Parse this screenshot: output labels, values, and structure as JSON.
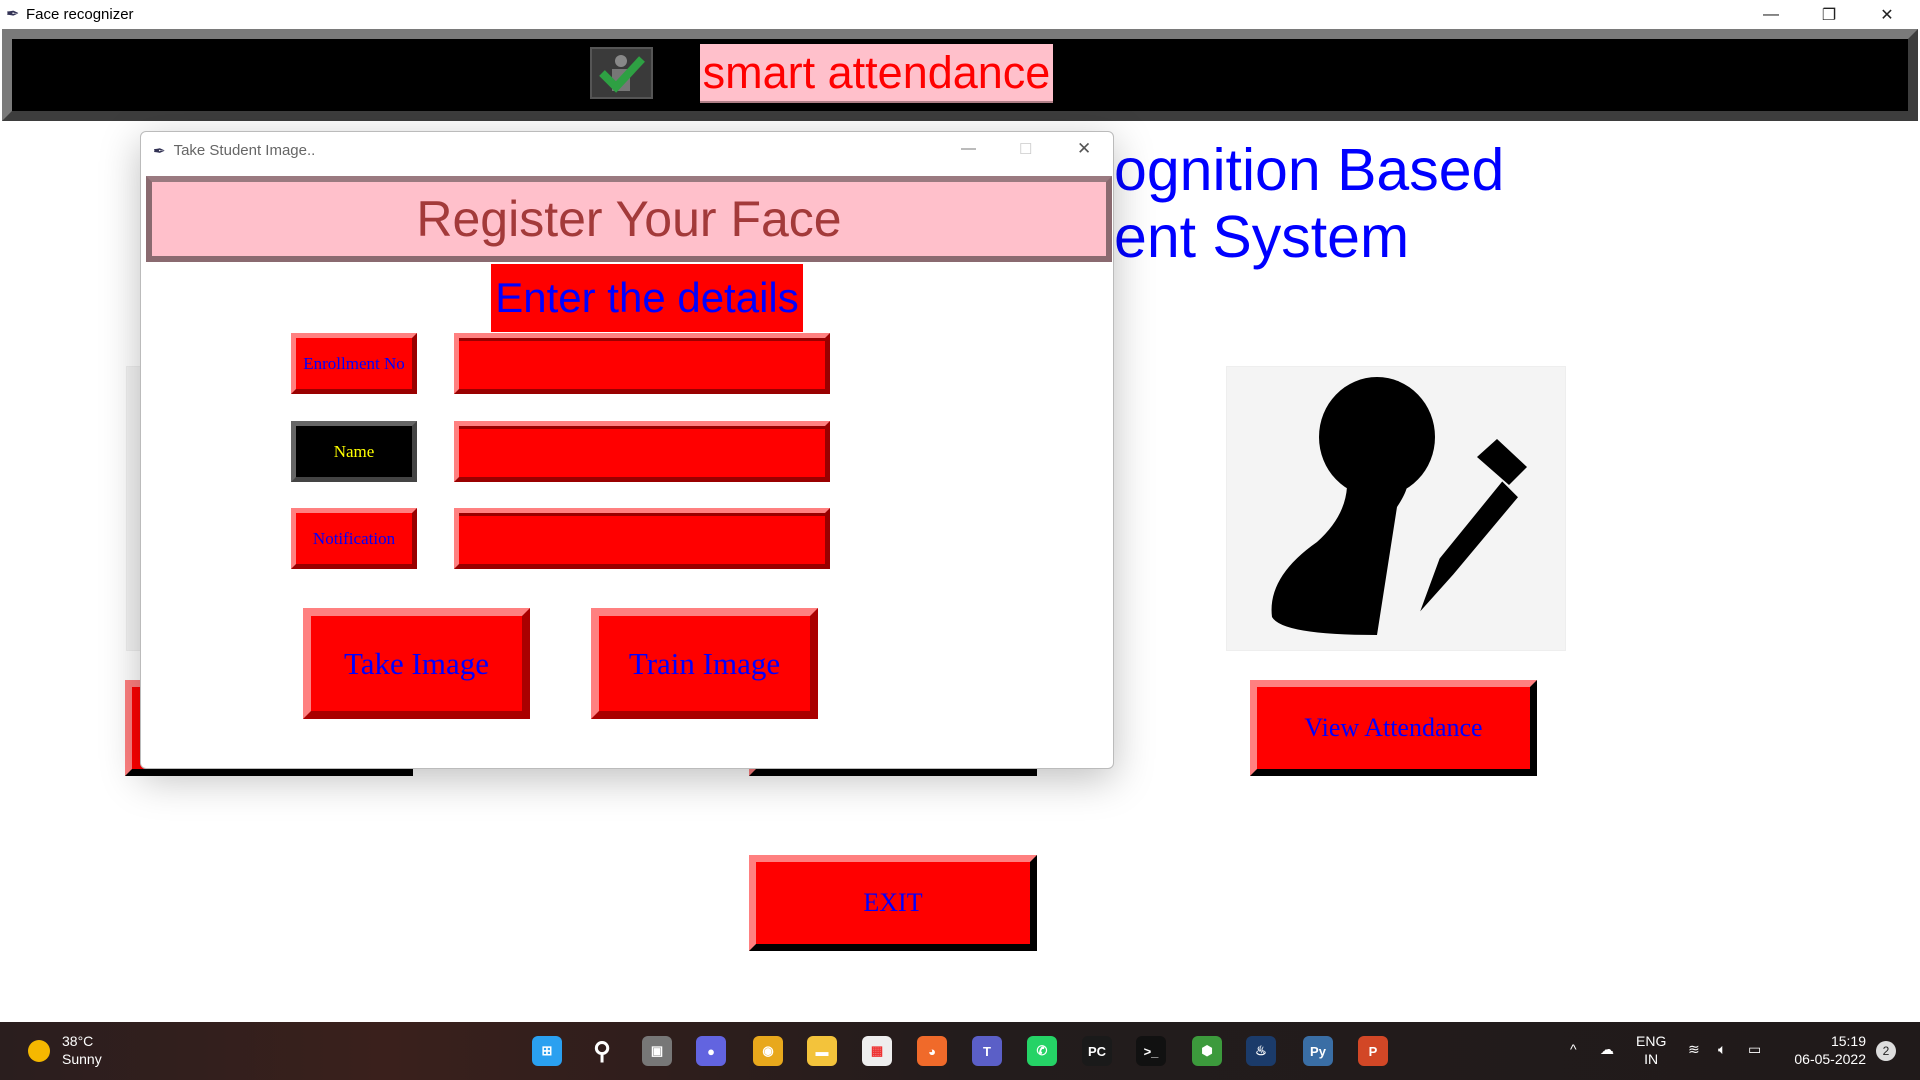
{
  "window": {
    "title": "Face recognizer",
    "controls": [
      "minimize",
      "restore",
      "close"
    ]
  },
  "header": {
    "label": "smart attendance",
    "icon": "attendance-check-icon"
  },
  "background": {
    "title_line1": "ognition Based",
    "title_line2": "ent System",
    "view_attendance": "View Attendance",
    "exit": "EXIT"
  },
  "dialog": {
    "title": "Take Student Image..",
    "heading": "Register Your Face",
    "subheading": "Enter the details",
    "fields": [
      {
        "label": "Enrollment No",
        "value": ""
      },
      {
        "label": "Name",
        "value": ""
      },
      {
        "label": "Notification",
        "value": ""
      }
    ],
    "take_image": "Take Image",
    "train_image": "Train Image"
  },
  "taskbar": {
    "weather_temp": "38°C",
    "weather_text": "Sunny",
    "lang1": "ENG",
    "lang2": "IN",
    "time": "15:19",
    "date": "06-05-2022",
    "notifications": "2",
    "apps": [
      {
        "name": "start",
        "color": "#2aa0f0",
        "glyph": "⊞"
      },
      {
        "name": "search",
        "color": "transparent",
        "glyph": "⚲"
      },
      {
        "name": "task-view",
        "color": "#777",
        "glyph": "▣"
      },
      {
        "name": "chat",
        "color": "#6264e0",
        "glyph": "●"
      },
      {
        "name": "chrome",
        "color": "#e8a81c",
        "glyph": "◉"
      },
      {
        "name": "file-explorer",
        "color": "#f3c33b",
        "glyph": "▬"
      },
      {
        "name": "store",
        "color": "#eee",
        "glyph": "▦"
      },
      {
        "name": "firefox",
        "color": "#f06a2a",
        "glyph": "◕"
      },
      {
        "name": "teams",
        "color": "#5b5fc7",
        "glyph": "T"
      },
      {
        "name": "whatsapp",
        "color": "#25d366",
        "glyph": "✆"
      },
      {
        "name": "pycharm",
        "color": "#1a1a1a",
        "glyph": "PC"
      },
      {
        "name": "terminal",
        "color": "#111",
        "glyph": ">_"
      },
      {
        "name": "nodejs",
        "color": "#3c9a3c",
        "glyph": "⬢"
      },
      {
        "name": "steam",
        "color": "#1b3b6a",
        "glyph": "♨"
      },
      {
        "name": "python",
        "color": "#3a6ea5",
        "glyph": "Py"
      },
      {
        "name": "powerpoint",
        "color": "#d24726",
        "glyph": "P"
      }
    ]
  }
}
